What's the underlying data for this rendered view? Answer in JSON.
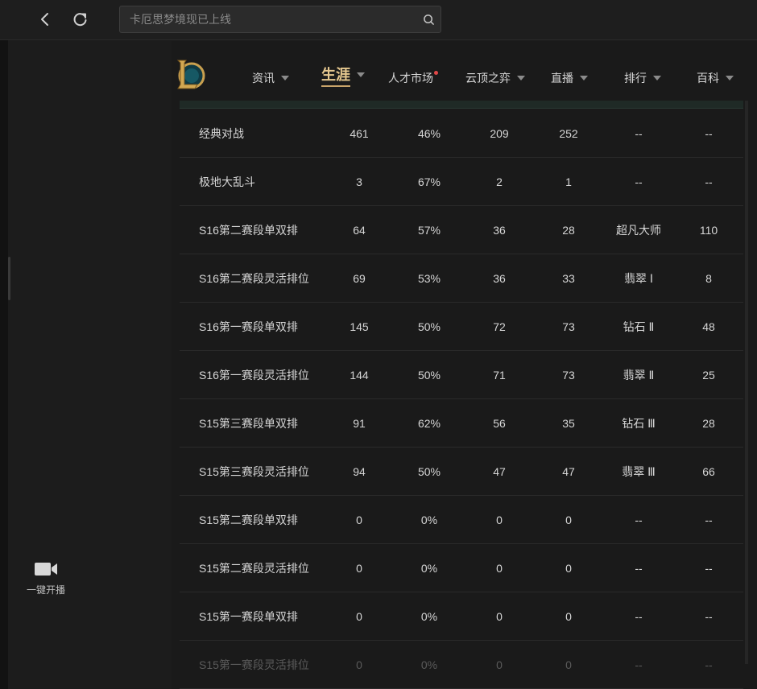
{
  "search": {
    "placeholder": "卡厄思梦境现已上线"
  },
  "sidebar": {
    "live_label": "一键开播"
  },
  "nav": {
    "items": [
      {
        "label": "资讯",
        "caret": true
      },
      {
        "label": "生涯",
        "caret": true,
        "active": true
      },
      {
        "label": "人才市场",
        "dot": true
      },
      {
        "label": "云顶之弈",
        "caret": true
      },
      {
        "label": "直播",
        "caret": true
      },
      {
        "label": "排行",
        "caret": true
      },
      {
        "label": "百科",
        "caret": true
      }
    ]
  },
  "table": {
    "rows": [
      {
        "mode": "经典对战",
        "total": "461",
        "winrate": "46%",
        "wins": "209",
        "losses": "252",
        "rank": "--",
        "points": "--"
      },
      {
        "mode": "极地大乱斗",
        "total": "3",
        "winrate": "67%",
        "wins": "2",
        "losses": "1",
        "rank": "--",
        "points": "--"
      },
      {
        "mode": "S16第二赛段单双排",
        "total": "64",
        "winrate": "57%",
        "wins": "36",
        "losses": "28",
        "rank": "超凡大师",
        "points": "110"
      },
      {
        "mode": "S16第二赛段灵活排位",
        "total": "69",
        "winrate": "53%",
        "wins": "36",
        "losses": "33",
        "rank": "翡翠 Ⅰ",
        "points": "8"
      },
      {
        "mode": "S16第一赛段单双排",
        "total": "145",
        "winrate": "50%",
        "wins": "72",
        "losses": "73",
        "rank": "钻石 Ⅱ",
        "points": "48"
      },
      {
        "mode": "S16第一赛段灵活排位",
        "total": "144",
        "winrate": "50%",
        "wins": "71",
        "losses": "73",
        "rank": "翡翠 Ⅱ",
        "points": "25"
      },
      {
        "mode": "S15第三赛段单双排",
        "total": "91",
        "winrate": "62%",
        "wins": "56",
        "losses": "35",
        "rank": "钻石 Ⅲ",
        "points": "28"
      },
      {
        "mode": "S15第三赛段灵活排位",
        "total": "94",
        "winrate": "50%",
        "wins": "47",
        "losses": "47",
        "rank": "翡翠 Ⅲ",
        "points": "66"
      },
      {
        "mode": "S15第二赛段单双排",
        "total": "0",
        "winrate": "0%",
        "wins": "0",
        "losses": "0",
        "rank": "--",
        "points": "--"
      },
      {
        "mode": "S15第二赛段灵活排位",
        "total": "0",
        "winrate": "0%",
        "wins": "0",
        "losses": "0",
        "rank": "--",
        "points": "--"
      },
      {
        "mode": "S15第一赛段单双排",
        "total": "0",
        "winrate": "0%",
        "wins": "0",
        "losses": "0",
        "rank": "--",
        "points": "--"
      },
      {
        "mode": "S15第一赛段灵活排位",
        "total": "0",
        "winrate": "0%",
        "wins": "0",
        "losses": "0",
        "rank": "--",
        "points": "--",
        "faded": true
      }
    ]
  }
}
